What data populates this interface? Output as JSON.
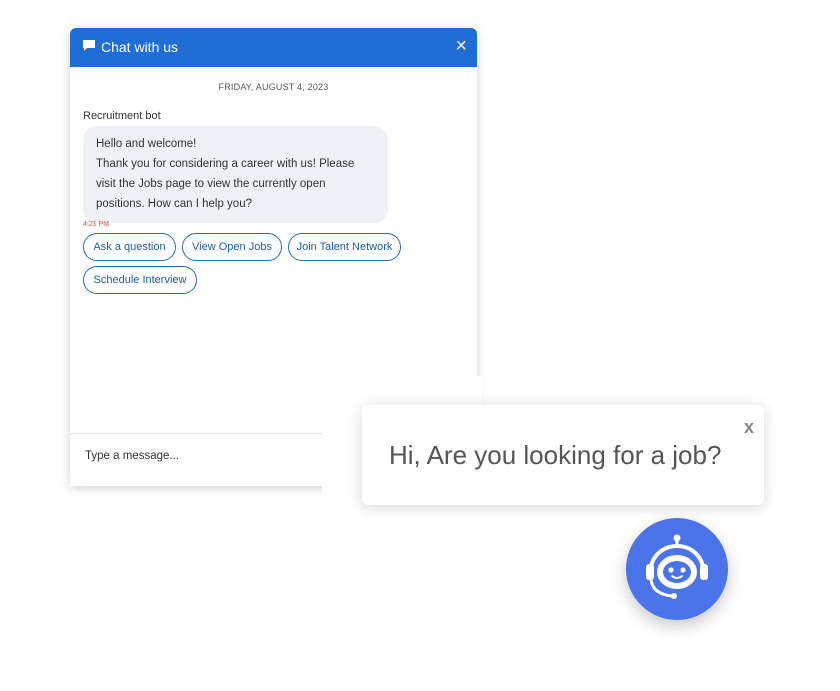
{
  "chat": {
    "title": "Chat with us",
    "close_label": "×",
    "date": "FRIDAY, AUGUST 4, 2023",
    "sender": "Recruitment bot",
    "message_lines": [
      "Hello and welcome!",
      "Thank you for considering a career with us! Please",
      "visit the Jobs page to view the currently open",
      "positions. How can I help you?"
    ],
    "timestamp": "4:21 PM",
    "quick_replies": [
      "Ask a question",
      "View Open Jobs",
      "Join Talent Network",
      "Schedule Interview"
    ],
    "input_placeholder": "Type a message..."
  },
  "greeting": {
    "text": "Hi, Are you looking for a job?",
    "close_label": "x"
  },
  "launcher": {
    "icon": "robot-headset-icon"
  },
  "colors": {
    "header": "#1f6ed6",
    "launcher": "#4b74ea",
    "bubble": "#eef2f6",
    "quick_reply_border": "#2a6db8"
  }
}
